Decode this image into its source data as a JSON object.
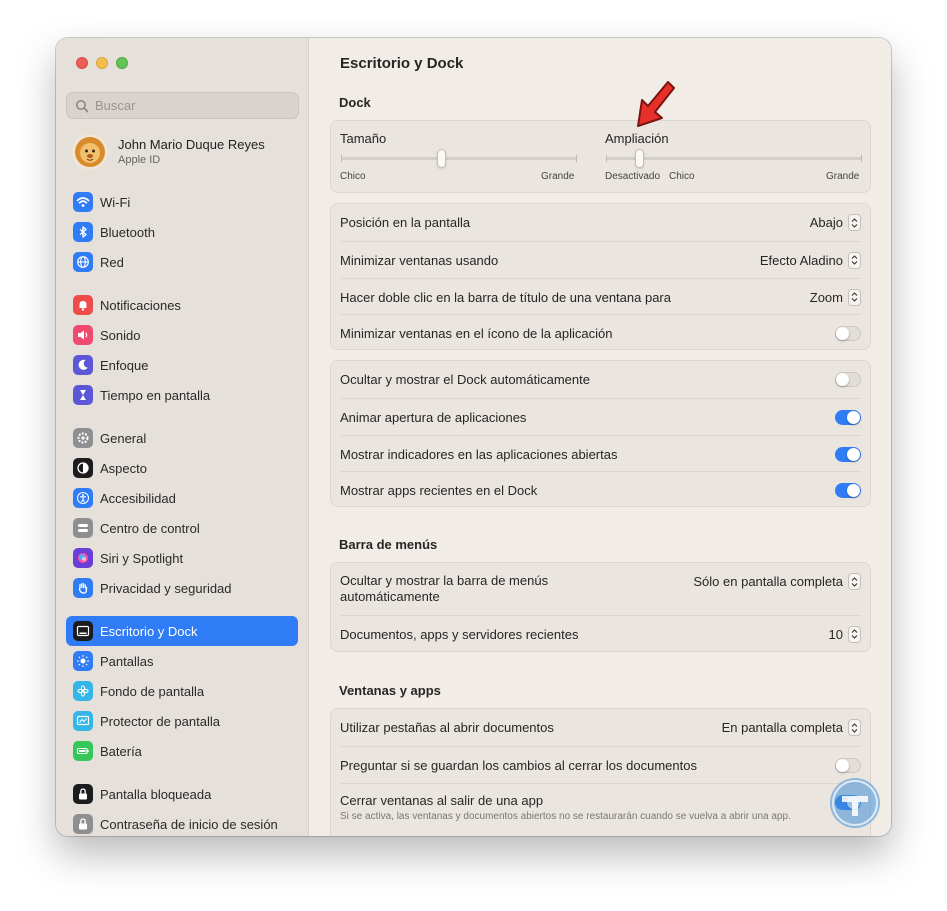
{
  "window": {
    "title": "Escritorio y Dock"
  },
  "sidebar": {
    "search_placeholder": "Buscar",
    "profile": {
      "name": "John Mario Duque Reyes",
      "subtitle": "Apple ID"
    },
    "items": [
      {
        "label": "Wi‑Fi",
        "icon": "wifi-icon",
        "color": "#2f7cf6"
      },
      {
        "label": "Bluetooth",
        "icon": "bluetooth-icon",
        "color": "#2f7cf6"
      },
      {
        "label": "Red",
        "icon": "globe-icon",
        "color": "#2f7cf6"
      },
      {
        "label": "Notificaciones",
        "icon": "bell-icon",
        "color": "#ef4b4b"
      },
      {
        "label": "Sonido",
        "icon": "speaker-icon",
        "color": "#ef4b6e"
      },
      {
        "label": "Enfoque",
        "icon": "moon-icon",
        "color": "#5b57d6"
      },
      {
        "label": "Tiempo en pantalla",
        "icon": "hourglass-icon",
        "color": "#5b57d6"
      },
      {
        "label": "General",
        "icon": "gear-icon",
        "color": "#8e8e93"
      },
      {
        "label": "Aspecto",
        "icon": "appearance-icon",
        "color": "#1c1c1e"
      },
      {
        "label": "Accesibilidad",
        "icon": "accessibility-icon",
        "color": "#2f7cf6"
      },
      {
        "label": "Centro de control",
        "icon": "control-center-icon",
        "color": "#8e8e93"
      },
      {
        "label": "Siri y Spotlight",
        "icon": "siri-icon",
        "color": "#6a3fd6"
      },
      {
        "label": "Privacidad y seguridad",
        "icon": "hand-icon",
        "color": "#2f7cf6"
      },
      {
        "label": "Escritorio y Dock",
        "icon": "dock-icon",
        "color": "#1c1c1e",
        "active": true
      },
      {
        "label": "Pantallas",
        "icon": "sun-icon",
        "color": "#2f7cf6"
      },
      {
        "label": "Fondo de pantalla",
        "icon": "flower-icon",
        "color": "#35b6e8"
      },
      {
        "label": "Protector de pantalla",
        "icon": "screensaver-icon",
        "color": "#35b6e8"
      },
      {
        "label": "Batería",
        "icon": "battery-icon",
        "color": "#34c759"
      },
      {
        "label": "Pantalla bloqueada",
        "icon": "lock-icon",
        "color": "#1c1c1e"
      },
      {
        "label": "Contraseña de inicio de sesión",
        "icon": "lock-icon",
        "color": "#8e8e93"
      }
    ]
  },
  "main": {
    "title": "Escritorio y Dock",
    "dock_section": {
      "title": "Dock",
      "size_slider": {
        "label": "Tamaño",
        "min_label": "Chico",
        "max_label": "Grande",
        "value": 0.45
      },
      "magnification_slider": {
        "label": "Ampliación",
        "off_label": "Desactivado",
        "min_label": "Chico",
        "max_label": "Grande",
        "value": 0.13
      },
      "rows_a": [
        {
          "label": "Posición en la pantalla",
          "value": "Abajo",
          "control": "popup"
        },
        {
          "label": "Minimizar ventanas usando",
          "value": "Efecto Aladino",
          "control": "popup"
        },
        {
          "label": "Hacer doble clic en la barra de título de una ventana para",
          "value": "Zoom",
          "control": "popup"
        },
        {
          "label": "Minimizar ventanas en el ícono de la aplicación",
          "control": "toggle",
          "on": false
        }
      ],
      "rows_b": [
        {
          "label": "Ocultar y mostrar el Dock automáticamente",
          "control": "toggle",
          "on": false
        },
        {
          "label": "Animar apertura de aplicaciones",
          "control": "toggle",
          "on": true
        },
        {
          "label": "Mostrar indicadores en las aplicaciones abiertas",
          "control": "toggle",
          "on": true
        },
        {
          "label": "Mostrar apps recientes en el Dock",
          "control": "toggle",
          "on": true
        }
      ]
    },
    "menubar_section": {
      "title": "Barra de menús",
      "rows": [
        {
          "label": "Ocultar y mostrar la barra de menús automáticamente",
          "value": "Sólo en pantalla completa",
          "control": "popup"
        },
        {
          "label": "Documentos, apps y servidores recientes",
          "value": "10",
          "control": "popup"
        }
      ]
    },
    "windows_section": {
      "title": "Ventanas y apps",
      "rows": [
        {
          "label": "Utilizar pestañas al abrir documentos",
          "value": "En pantalla completa",
          "control": "popup"
        },
        {
          "label": "Preguntar si se guardan los cambios al cerrar los documentos",
          "control": "toggle",
          "on": false
        },
        {
          "label": "Cerrar ventanas al salir de una app",
          "note": "Si se activa, las ventanas y documentos abiertos no se restaurarán cuando se vuelva a abrir una app.",
          "control": "toggle",
          "on": true
        }
      ]
    }
  },
  "colors": {
    "accent": "#2f7cf6",
    "annotation_arrow": "#e8302a"
  }
}
